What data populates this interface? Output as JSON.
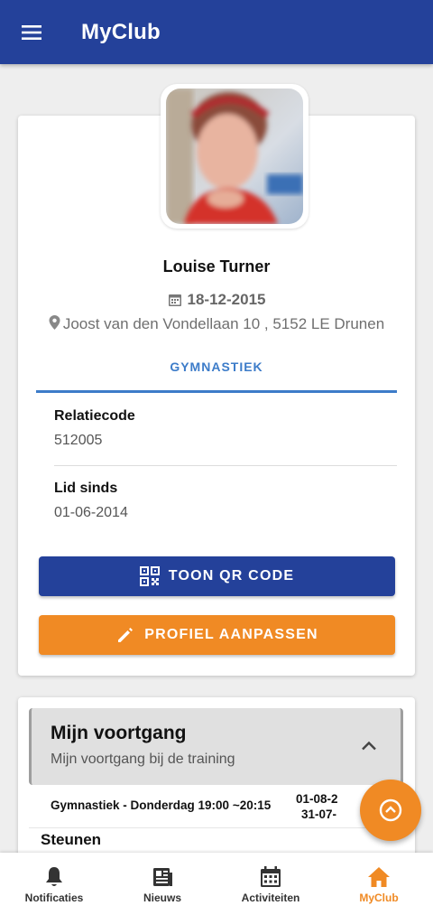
{
  "app": {
    "title": "MyClub"
  },
  "profile": {
    "name": "Louise Turner",
    "birth_date": "18-12-2015",
    "address": "Joost van den Vondellaan 10 , 5152 LE Drunen",
    "tab": "GYMNASTIEK",
    "fields": [
      {
        "label": "Relatiecode",
        "value": "512005"
      },
      {
        "label": "Lid sinds",
        "value": "01-06-2014"
      }
    ],
    "qr_button": "TOON QR CODE",
    "edit_button": "PROFIEL AANPASSEN"
  },
  "progress": {
    "title": "Mijn voortgang",
    "subtitle": "Mijn voortgang bij de training",
    "trainings": [
      {
        "label": "Gymnastiek - Donderdag 19:00 ~20:15",
        "date_start": "01-08-2",
        "date_end": "31-07-"
      }
    ],
    "section": "Steunen"
  },
  "bottom_nav": [
    {
      "label": "Notificaties",
      "icon": "bell-icon",
      "active": false
    },
    {
      "label": "Nieuws",
      "icon": "newspaper-icon",
      "active": false
    },
    {
      "label": "Activiteiten",
      "icon": "calendar-icon",
      "active": false
    },
    {
      "label": "MyClub",
      "icon": "home-icon",
      "active": true
    }
  ],
  "colors": {
    "primary": "#24419a",
    "accent": "#f08a24",
    "link": "#3d7cc9"
  }
}
